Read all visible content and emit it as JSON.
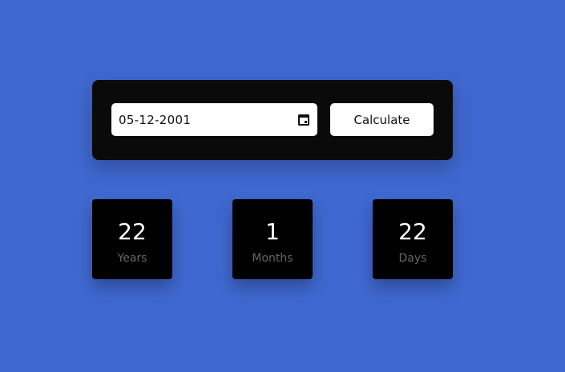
{
  "colors": {
    "background": "#3f68d0",
    "card": "#0a0a0a",
    "result_box": "#000000",
    "result_label": "#666666",
    "input_bg": "#ffffff",
    "text_dark": "#111111",
    "text_light": "#ffffff"
  },
  "form": {
    "date_value": "05-12-2001",
    "calendar_icon": "calendar-icon",
    "calculate_label": "Calculate"
  },
  "results": {
    "years": {
      "value": "22",
      "label": "Years"
    },
    "months": {
      "value": "1",
      "label": "Months"
    },
    "days": {
      "value": "22",
      "label": "Days"
    }
  }
}
